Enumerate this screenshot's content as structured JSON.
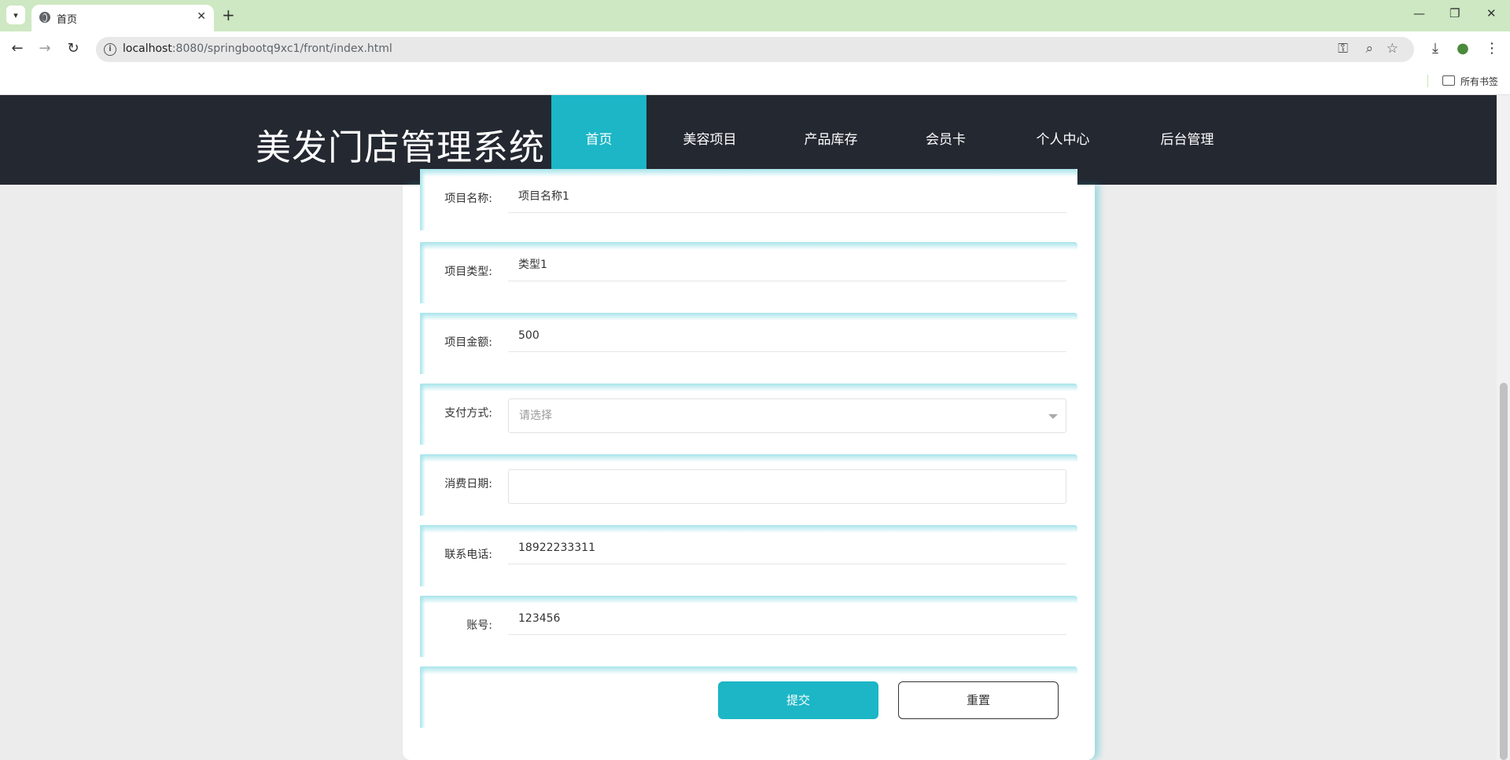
{
  "browser": {
    "tab_title": "首页",
    "url_host": "localhost",
    "url_rest": ":8080/springbootq9xc1/front/index.html",
    "bookmarks_label": "所有书签"
  },
  "header": {
    "title": "美发门店管理系统",
    "nav": [
      {
        "label": "首页",
        "active": true
      },
      {
        "label": "美容项目",
        "active": false
      },
      {
        "label": "产品库存",
        "active": false
      },
      {
        "label": "会员卡",
        "active": false
      },
      {
        "label": "个人中心",
        "active": false
      },
      {
        "label": "后台管理",
        "active": false
      }
    ]
  },
  "form": {
    "fields": [
      {
        "label": "项目名称:",
        "value": "项目名称1"
      },
      {
        "label": "项目类型:",
        "value": "类型1"
      },
      {
        "label": "项目金额:",
        "value": "500"
      },
      {
        "label": "支付方式:",
        "placeholder": "请选择"
      },
      {
        "label": "消费日期:",
        "value": ""
      },
      {
        "label": "联系电话:",
        "value": "18922233311"
      },
      {
        "label": "账号:",
        "value": "123456"
      }
    ],
    "submit_label": "提交",
    "reset_label": "重置"
  },
  "colors": {
    "accent": "#1cb6c6",
    "header_bg": "#242831",
    "tabbar_bg": "#cde8c2"
  }
}
